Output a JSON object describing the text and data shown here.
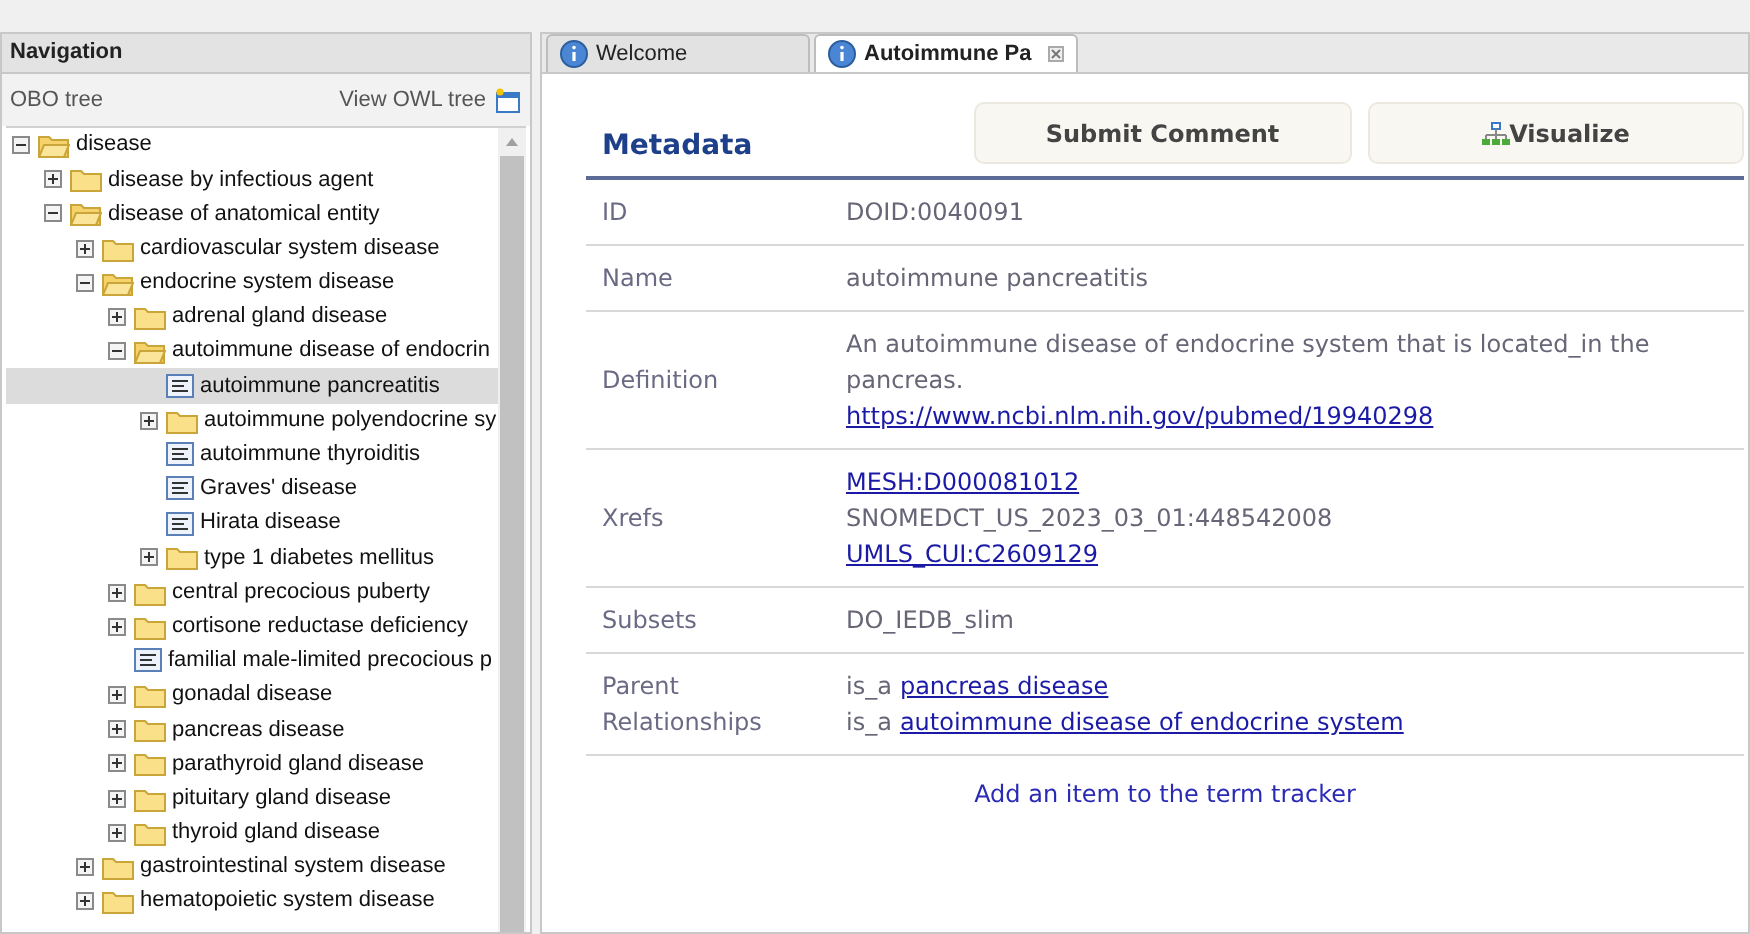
{
  "navigation": {
    "title": "Navigation",
    "tree_label": "OBO tree",
    "owl_link": "View OWL tree"
  },
  "tree": [
    {
      "label": "disease",
      "kind": "folder",
      "expanded": true,
      "selected": false,
      "children": [
        {
          "label": "disease by infectious agent",
          "kind": "folder",
          "expanded": false,
          "selected": false
        },
        {
          "label": "disease of anatomical entity",
          "kind": "folder",
          "expanded": true,
          "selected": false,
          "children": [
            {
              "label": "cardiovascular system disease",
              "kind": "folder",
              "expanded": false,
              "selected": false
            },
            {
              "label": "endocrine system disease",
              "kind": "folder",
              "expanded": true,
              "selected": false,
              "children": [
                {
                  "label": "adrenal gland disease",
                  "kind": "folder",
                  "expanded": false,
                  "selected": false
                },
                {
                  "label": "autoimmune disease of endocrin",
                  "kind": "folder",
                  "expanded": true,
                  "selected": false,
                  "children": [
                    {
                      "label": "autoimmune pancreatitis",
                      "kind": "leaf",
                      "selected": true
                    },
                    {
                      "label": "autoimmune polyendocrine sy",
                      "kind": "folder",
                      "expanded": false,
                      "selected": false
                    },
                    {
                      "label": "autoimmune thyroiditis",
                      "kind": "leaf",
                      "selected": false
                    },
                    {
                      "label": "Graves' disease",
                      "kind": "leaf",
                      "selected": false
                    },
                    {
                      "label": "Hirata disease",
                      "kind": "leaf",
                      "selected": false
                    },
                    {
                      "label": "type 1 diabetes mellitus",
                      "kind": "folder",
                      "expanded": false,
                      "selected": false
                    }
                  ]
                },
                {
                  "label": "central precocious puberty",
                  "kind": "folder",
                  "expanded": false,
                  "selected": false
                },
                {
                  "label": "cortisone reductase deficiency",
                  "kind": "folder",
                  "expanded": false,
                  "selected": false
                },
                {
                  "label": "familial male-limited precocious p",
                  "kind": "leaf",
                  "selected": false
                },
                {
                  "label": "gonadal disease",
                  "kind": "folder",
                  "expanded": false,
                  "selected": false
                },
                {
                  "label": "pancreas disease",
                  "kind": "folder",
                  "expanded": false,
                  "selected": false
                },
                {
                  "label": "parathyroid gland disease",
                  "kind": "folder",
                  "expanded": false,
                  "selected": false
                },
                {
                  "label": "pituitary gland disease",
                  "kind": "folder",
                  "expanded": false,
                  "selected": false
                },
                {
                  "label": "thyroid gland disease",
                  "kind": "folder",
                  "expanded": false,
                  "selected": false
                }
              ]
            },
            {
              "label": "gastrointestinal system disease",
              "kind": "folder",
              "expanded": false,
              "selected": false
            },
            {
              "label": "hematopoietic system disease",
              "kind": "folder",
              "expanded": false,
              "selected": false
            }
          ]
        }
      ]
    }
  ],
  "tabs": [
    {
      "label": "Welcome",
      "selected": false,
      "closable": false
    },
    {
      "label": "Autoimmune Pa",
      "selected": true,
      "closable": true
    }
  ],
  "metadata": {
    "title": "Metadata",
    "buttons": [
      {
        "label": "Submit Comment",
        "kind": "plain"
      },
      {
        "label": "Visualize",
        "kind": "tree"
      }
    ],
    "rows": [
      {
        "label": "ID",
        "lines": [
          [
            {
              "text": "DOID:0040091",
              "link": false
            }
          ]
        ]
      },
      {
        "label": "Name",
        "lines": [
          [
            {
              "text": "autoimmune pancreatitis",
              "link": false
            }
          ]
        ]
      },
      {
        "label": "Definition",
        "lines": [
          [
            {
              "text": "An autoimmune disease of endocrine system that is located_in the pancreas.",
              "link": false
            }
          ],
          [
            {
              "text": "https://www.ncbi.nlm.nih.gov/pubmed/19940298",
              "link": true
            }
          ]
        ]
      },
      {
        "label": "Xrefs",
        "lines": [
          [
            {
              "text": "MESH:D000081012",
              "link": true
            }
          ],
          [
            {
              "text": "SNOMEDCT_US_2023_03_01:448542008",
              "link": false
            }
          ],
          [
            {
              "text": "UMLS_CUI:C2609129",
              "link": true
            }
          ]
        ]
      },
      {
        "label": "Subsets",
        "lines": [
          [
            {
              "text": "DO_IEDB_slim",
              "link": false
            }
          ]
        ]
      },
      {
        "label": "Parent Relationships",
        "lines": [
          [
            {
              "text": "is_a",
              "link": false
            },
            {
              "text": "pancreas disease",
              "link": true
            }
          ],
          [
            {
              "text": "is_a",
              "link": false
            },
            {
              "text": "autoimmune disease of endocrine system",
              "link": true
            }
          ]
        ]
      }
    ],
    "tracker_link": "Add an item to the term tracker"
  }
}
